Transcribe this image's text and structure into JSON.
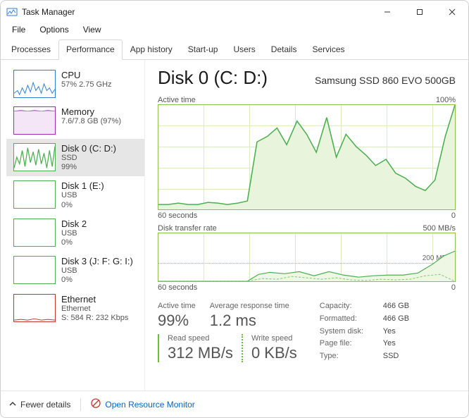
{
  "window": {
    "title": "Task Manager"
  },
  "menu": {
    "file": "File",
    "options": "Options",
    "view": "View"
  },
  "tabs": {
    "processes": "Processes",
    "performance": "Performance",
    "app_history": "App history",
    "startup": "Start-up",
    "users": "Users",
    "details": "Details",
    "services": "Services"
  },
  "sidebar": {
    "items": [
      {
        "title": "CPU",
        "sub1": "57% 2.75 GHz",
        "color": "#2f7ed8"
      },
      {
        "title": "Memory",
        "sub1": "7.6/7.8 GB (97%)",
        "color": "#9b2fae"
      },
      {
        "title": "Disk 0 (C: D:)",
        "sub1": "SSD",
        "sub2": "99%",
        "color": "#4caf50",
        "selected": true
      },
      {
        "title": "Disk 1 (E:)",
        "sub1": "USB",
        "sub2": "0%",
        "color": "#4caf50"
      },
      {
        "title": "Disk 2",
        "sub1": "USB",
        "sub2": "0%",
        "color": "#4caf50"
      },
      {
        "title": "Disk 3 (J: F: G: I:)",
        "sub1": "USB",
        "sub2": "0%",
        "color": "#4caf50"
      },
      {
        "title": "Ethernet",
        "sub1": "Ethernet",
        "sub2": "S: 584 R: 232 Kbps",
        "color": "#c0392b"
      }
    ]
  },
  "main": {
    "title": "Disk 0 (C: D:)",
    "device": "Samsung SSD 860 EVO 500GB",
    "chart1": {
      "label": "Active time",
      "max": "100%",
      "xleft": "60 seconds",
      "xright": "0"
    },
    "chart2": {
      "label": "Disk transfer rate",
      "max": "500 MB/s",
      "mid": "200 MB/s",
      "xleft": "60 seconds",
      "xright": "0"
    },
    "metrics": {
      "active_time": {
        "label": "Active time",
        "value": "99%"
      },
      "avg_response": {
        "label": "Average response time",
        "value": "1.2 ms"
      },
      "read": {
        "label": "Read speed",
        "value": "312 MB/s"
      },
      "write": {
        "label": "Write speed",
        "value": "0 KB/s"
      }
    },
    "props": {
      "capacity": {
        "k": "Capacity:",
        "v": "466 GB"
      },
      "formatted": {
        "k": "Formatted:",
        "v": "466 GB"
      },
      "system_disk": {
        "k": "System disk:",
        "v": "Yes"
      },
      "page_file": {
        "k": "Page file:",
        "v": "Yes"
      },
      "type": {
        "k": "Type:",
        "v": "SSD"
      }
    }
  },
  "footer": {
    "fewer": "Fewer details",
    "resmon": "Open Resource Monitor"
  },
  "chart_data": [
    {
      "type": "area",
      "title": "Active time",
      "xlabel": "seconds",
      "ylabel": "Active time %",
      "xlim": [
        60,
        0
      ],
      "ylim": [
        0,
        100
      ],
      "x": [
        60,
        58,
        56,
        54,
        52,
        50,
        48,
        46,
        44,
        42,
        40,
        38,
        36,
        34,
        32,
        30,
        28,
        26,
        24,
        22,
        20,
        18,
        16,
        14,
        12,
        10,
        8,
        6,
        4,
        2,
        0
      ],
      "values": [
        5,
        5,
        6,
        5,
        5,
        7,
        6,
        5,
        6,
        8,
        65,
        70,
        78,
        62,
        85,
        72,
        55,
        88,
        50,
        72,
        60,
        52,
        42,
        48,
        35,
        30,
        22,
        18,
        28,
        70,
        100
      ]
    },
    {
      "type": "line",
      "title": "Disk transfer rate",
      "xlabel": "seconds",
      "ylabel": "MB/s",
      "xlim": [
        60,
        0
      ],
      "ylim": [
        0,
        500
      ],
      "annotations": [
        "200 MB/s"
      ],
      "series": [
        {
          "name": "Read",
          "x": [
            60,
            55,
            50,
            45,
            40,
            35,
            30,
            25,
            20,
            15,
            10,
            5,
            0
          ],
          "values": [
            0,
            0,
            0,
            0,
            70,
            90,
            80,
            100,
            60,
            40,
            60,
            180,
            312
          ]
        },
        {
          "name": "Write",
          "x": [
            60,
            55,
            50,
            45,
            40,
            35,
            30,
            25,
            20,
            15,
            10,
            5,
            0
          ],
          "values": [
            0,
            0,
            0,
            0,
            30,
            20,
            50,
            40,
            20,
            10,
            20,
            60,
            0
          ]
        }
      ]
    }
  ]
}
